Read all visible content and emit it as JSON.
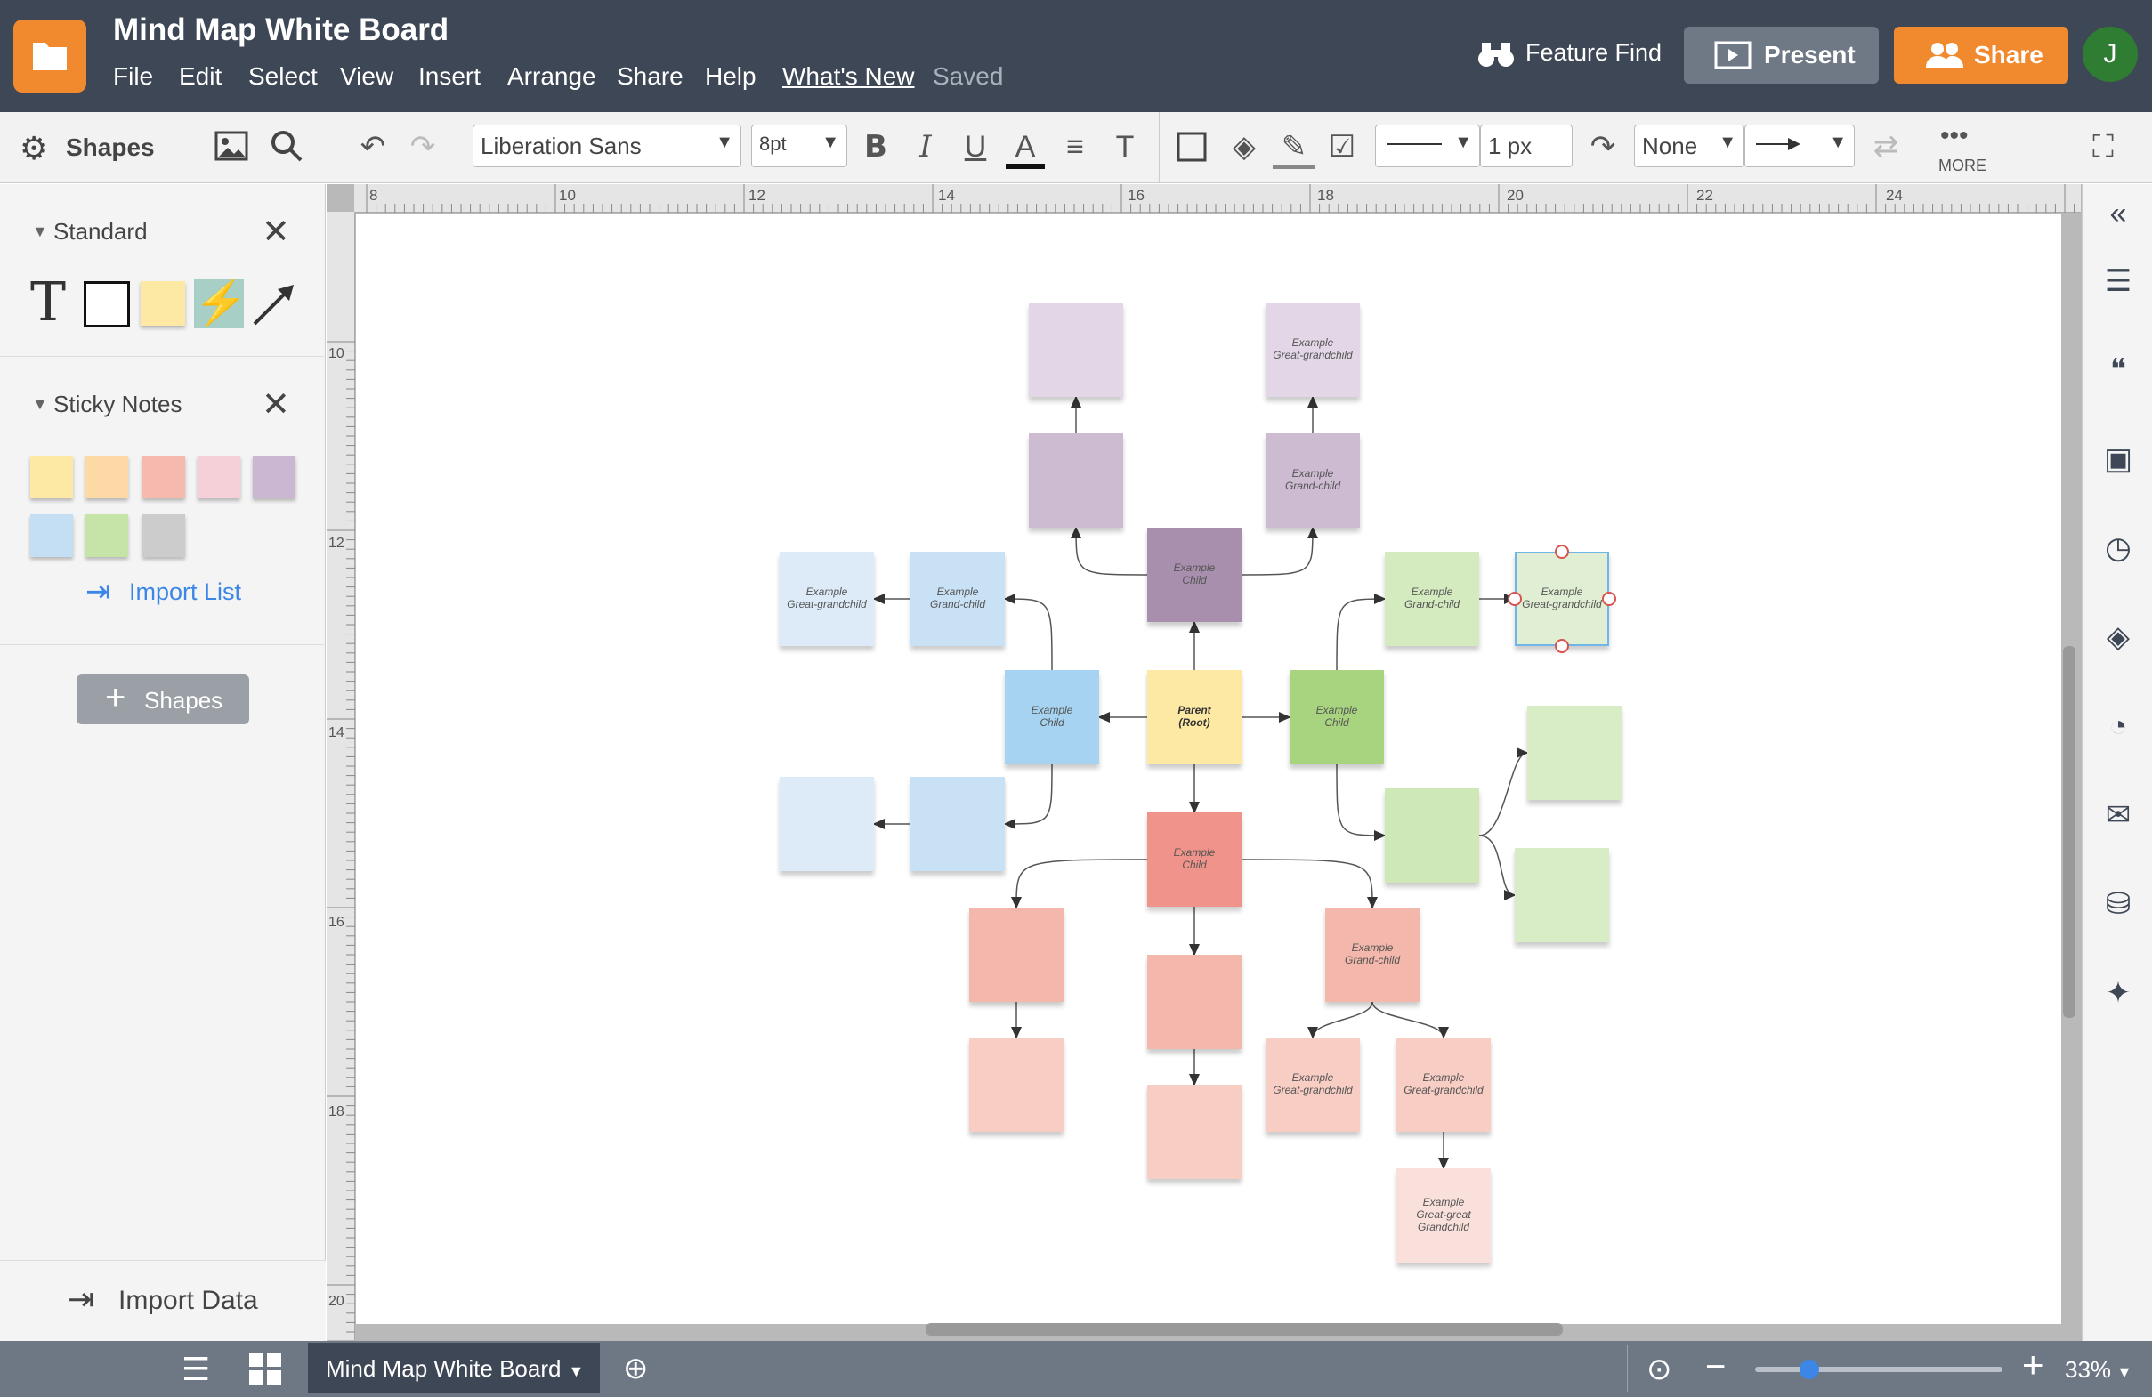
{
  "app": {
    "title": "Mind Map White Board",
    "menu": [
      "File",
      "Edit",
      "Select",
      "View",
      "Insert",
      "Arrange",
      "Share",
      "Help",
      "What's New"
    ],
    "status": "Saved",
    "feature_find": "Feature Find",
    "present": "Present",
    "share": "Share",
    "avatar": "J"
  },
  "toolbar": {
    "shapes": "Shapes",
    "font": "Liberation Sans",
    "size": "8pt",
    "line_width": "1 px",
    "endpoint": "None",
    "more": "MORE"
  },
  "sidebar": {
    "standard": "Standard",
    "sticky": "Sticky Notes",
    "import_list": "Import List",
    "add_shapes": "Shapes",
    "import_data": "Import Data"
  },
  "sticky_colors": [
    "#fde8a4",
    "#fdd9a6",
    "#f6b9ad",
    "#f5d0d9",
    "#cbb7d1",
    "#c4dff4",
    "#c6e3a8",
    "#cccccc"
  ],
  "ruler_top": [
    "8",
    "10",
    "12",
    "14",
    "16",
    "18",
    "20",
    "22",
    "24"
  ],
  "ruler_left": [
    "10",
    "12",
    "14",
    "16",
    "18",
    "20"
  ],
  "bottom": {
    "page_tab": "Mind Map White Board",
    "zoom": "33%",
    "zoom_level": 0.22
  },
  "nodes": [
    {
      "t": "",
      "c": "#e3d6e6"
    },
    {
      "t": "Example\nGreat-grandchild",
      "c": "#e3d6e6"
    },
    {
      "t": "",
      "c": "#cdbbd2"
    },
    {
      "t": "Example\nGrand-child",
      "c": "#cdbbd2"
    },
    {
      "t": "Example\nChild",
      "c": "#a88fae"
    },
    {
      "t": "Example\nGreat-grandchild",
      "c": "#dcebf7"
    },
    {
      "t": "Example\nGrand-child",
      "c": "#c8e1f5"
    },
    {
      "t": "Example\nGrand-child",
      "c": "#d4ebbf"
    },
    {
      "t": "Example\nGreat-grandchild",
      "c": "#e0efd3"
    },
    {
      "t": "Example\nChild",
      "c": "#a6d3f1"
    },
    {
      "t": "Parent\n(Root)",
      "c": "#fde8a4"
    },
    {
      "t": "Example\nChild",
      "c": "#a8d47f"
    },
    {
      "t": "",
      "c": "#d8ecc6"
    },
    {
      "t": "",
      "c": "#cfe8b8"
    },
    {
      "t": "",
      "c": "#d8ecc6"
    },
    {
      "t": "",
      "c": "#dcebf7"
    },
    {
      "t": "",
      "c": "#c8e1f5"
    },
    {
      "t": "Example\nChild",
      "c": "#f0938a"
    },
    {
      "t": "",
      "c": "#f3b7ab"
    },
    {
      "t": "",
      "c": "#f3b7ab"
    },
    {
      "t": "Example\nGrand-child",
      "c": "#f3b7ab"
    },
    {
      "t": "",
      "c": "#f7cdc4"
    },
    {
      "t": "",
      "c": "#f7cdc4"
    },
    {
      "t": "Example\nGreat-grandchild",
      "c": "#f7cdc4"
    },
    {
      "t": "Example\nGreat-grandchild",
      "c": "#f7cdc4"
    },
    {
      "t": "Example\nGreat-great\nGrandchild",
      "c": "#fae0da"
    }
  ]
}
